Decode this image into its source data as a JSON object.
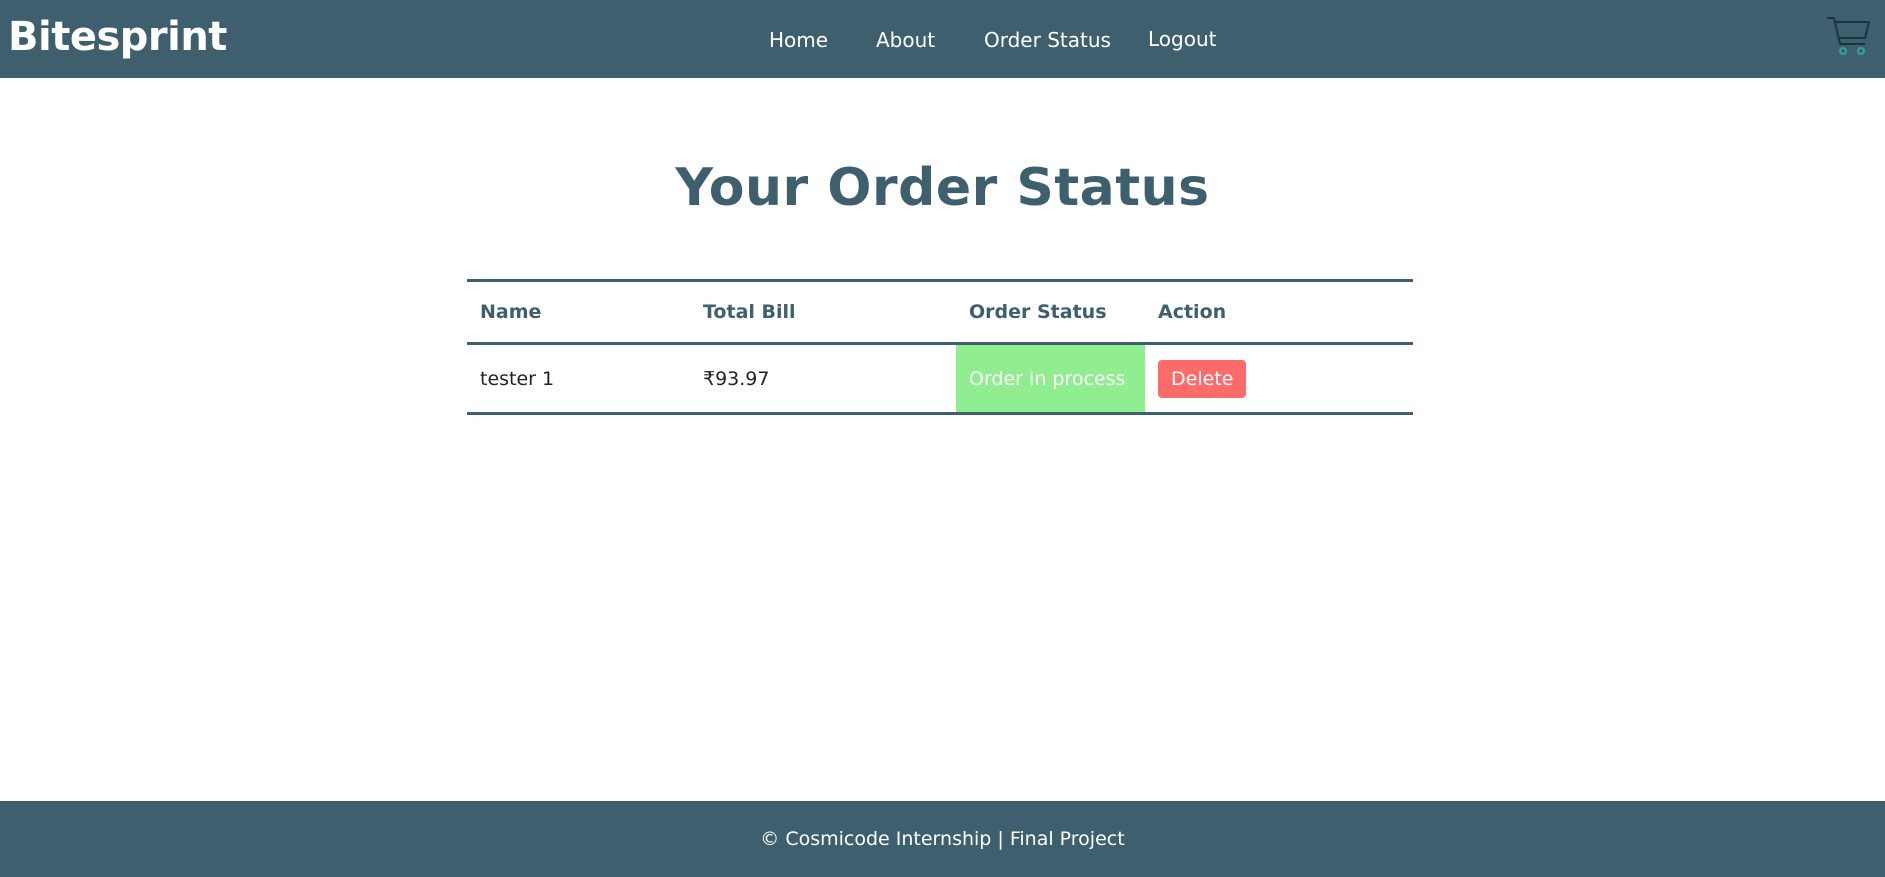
{
  "header": {
    "brand": "Bitesprint",
    "nav": [
      {
        "label": "Home"
      },
      {
        "label": "About"
      },
      {
        "label": "Order Status"
      },
      {
        "label": "Logout"
      }
    ],
    "cart_icon": "shopping-cart-icon"
  },
  "main": {
    "title": "Your Order Status",
    "table": {
      "headers": [
        "Name",
        "Total Bill",
        "Order Status",
        "Action"
      ],
      "rows": [
        {
          "name": "tester 1",
          "total_bill": "₹93.97",
          "order_status": "Order in process",
          "action_label": "Delete"
        }
      ]
    }
  },
  "footer": {
    "text": "© Cosmicode Internship | Final Project"
  },
  "colors": {
    "primary": "#3d5f6e",
    "status_in_process": "#90ee90",
    "delete": "#ff6b6b",
    "cart_wheels": "#2aa8a0"
  }
}
